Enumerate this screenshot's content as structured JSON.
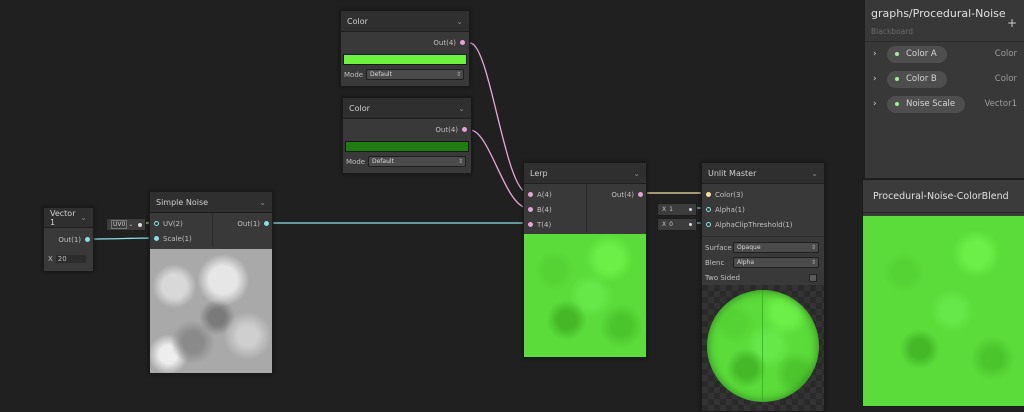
{
  "color_node_a": {
    "title": "Color",
    "out_label": "Out(4)",
    "swatch_color": "#6df23e",
    "mode_label": "Mode",
    "mode_value": "Default"
  },
  "color_node_b": {
    "title": "Color",
    "out_label": "Out(4)",
    "swatch_color": "#1f7d12",
    "mode_label": "Mode",
    "mode_value": "Default"
  },
  "vector1_node": {
    "title": "Vector 1",
    "out_label": "Out(1)",
    "x_label": "X",
    "x_value": "20"
  },
  "uv_field": {
    "value": "UV0"
  },
  "simple_noise_node": {
    "title": "Simple Noise",
    "uv_label": "UV(2)",
    "scale_label": "Scale(1)",
    "out_label": "Out(1)"
  },
  "lerp_node": {
    "title": "Lerp",
    "a_label": "A(4)",
    "b_label": "B(4)",
    "t_label": "T(4)",
    "out_label": "Out(4)"
  },
  "alpha_field": {
    "label": "X",
    "value": "1"
  },
  "alpha_clip_field": {
    "label": "X",
    "value": "0"
  },
  "unlit_master_node": {
    "title": "Unlit Master",
    "color_label": "Color(3)",
    "alpha_label": "Alpha(1)",
    "clip_label": "AlphaClipThreshold(1)",
    "surface_label": "Surface",
    "surface_value": "Opaque",
    "blend_label": "Blenc",
    "blend_value": "Alpha",
    "two_sided_label": "Two Sided"
  },
  "blackboard": {
    "title": "graphs/Procedural-Noise",
    "subtitle": "Blackboard",
    "add_glyph": "+",
    "items": [
      {
        "name": "Color A",
        "type": "Color"
      },
      {
        "name": "Color B",
        "type": "Color"
      },
      {
        "name": "Noise Scale",
        "type": "Vector1"
      }
    ]
  },
  "main_preview": {
    "title": "Procedural-Noise-ColorBlend"
  },
  "colors": {
    "wire_pink": "#e4a8d8",
    "wire_cyan": "#8ee0e2",
    "wire_yellow": "#f0e4a2",
    "preview_green": "#5bdc3a"
  },
  "icons": [
    "chevron-down-icon",
    "chevron-right-icon",
    "plus-icon",
    "dropdown-arrow-icon",
    "checkbox-icon"
  ]
}
